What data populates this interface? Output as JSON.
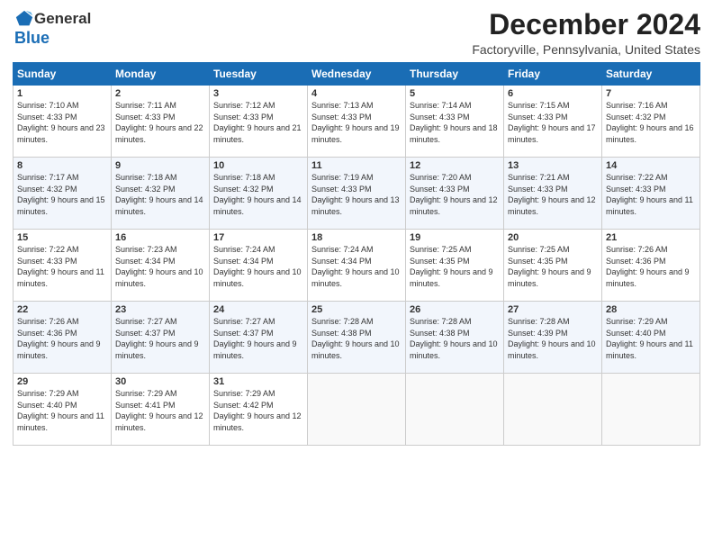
{
  "header": {
    "logo_line1": "General",
    "logo_line2": "Blue",
    "title": "December 2024",
    "subtitle": "Factoryville, Pennsylvania, United States"
  },
  "days_of_week": [
    "Sunday",
    "Monday",
    "Tuesday",
    "Wednesday",
    "Thursday",
    "Friday",
    "Saturday"
  ],
  "weeks": [
    [
      {
        "day": "1",
        "sunrise": "Sunrise: 7:10 AM",
        "sunset": "Sunset: 4:33 PM",
        "daylight": "Daylight: 9 hours and 23 minutes."
      },
      {
        "day": "2",
        "sunrise": "Sunrise: 7:11 AM",
        "sunset": "Sunset: 4:33 PM",
        "daylight": "Daylight: 9 hours and 22 minutes."
      },
      {
        "day": "3",
        "sunrise": "Sunrise: 7:12 AM",
        "sunset": "Sunset: 4:33 PM",
        "daylight": "Daylight: 9 hours and 21 minutes."
      },
      {
        "day": "4",
        "sunrise": "Sunrise: 7:13 AM",
        "sunset": "Sunset: 4:33 PM",
        "daylight": "Daylight: 9 hours and 19 minutes."
      },
      {
        "day": "5",
        "sunrise": "Sunrise: 7:14 AM",
        "sunset": "Sunset: 4:33 PM",
        "daylight": "Daylight: 9 hours and 18 minutes."
      },
      {
        "day": "6",
        "sunrise": "Sunrise: 7:15 AM",
        "sunset": "Sunset: 4:33 PM",
        "daylight": "Daylight: 9 hours and 17 minutes."
      },
      {
        "day": "7",
        "sunrise": "Sunrise: 7:16 AM",
        "sunset": "Sunset: 4:32 PM",
        "daylight": "Daylight: 9 hours and 16 minutes."
      }
    ],
    [
      {
        "day": "8",
        "sunrise": "Sunrise: 7:17 AM",
        "sunset": "Sunset: 4:32 PM",
        "daylight": "Daylight: 9 hours and 15 minutes."
      },
      {
        "day": "9",
        "sunrise": "Sunrise: 7:18 AM",
        "sunset": "Sunset: 4:32 PM",
        "daylight": "Daylight: 9 hours and 14 minutes."
      },
      {
        "day": "10",
        "sunrise": "Sunrise: 7:18 AM",
        "sunset": "Sunset: 4:32 PM",
        "daylight": "Daylight: 9 hours and 14 minutes."
      },
      {
        "day": "11",
        "sunrise": "Sunrise: 7:19 AM",
        "sunset": "Sunset: 4:33 PM",
        "daylight": "Daylight: 9 hours and 13 minutes."
      },
      {
        "day": "12",
        "sunrise": "Sunrise: 7:20 AM",
        "sunset": "Sunset: 4:33 PM",
        "daylight": "Daylight: 9 hours and 12 minutes."
      },
      {
        "day": "13",
        "sunrise": "Sunrise: 7:21 AM",
        "sunset": "Sunset: 4:33 PM",
        "daylight": "Daylight: 9 hours and 12 minutes."
      },
      {
        "day": "14",
        "sunrise": "Sunrise: 7:22 AM",
        "sunset": "Sunset: 4:33 PM",
        "daylight": "Daylight: 9 hours and 11 minutes."
      }
    ],
    [
      {
        "day": "15",
        "sunrise": "Sunrise: 7:22 AM",
        "sunset": "Sunset: 4:33 PM",
        "daylight": "Daylight: 9 hours and 11 minutes."
      },
      {
        "day": "16",
        "sunrise": "Sunrise: 7:23 AM",
        "sunset": "Sunset: 4:34 PM",
        "daylight": "Daylight: 9 hours and 10 minutes."
      },
      {
        "day": "17",
        "sunrise": "Sunrise: 7:24 AM",
        "sunset": "Sunset: 4:34 PM",
        "daylight": "Daylight: 9 hours and 10 minutes."
      },
      {
        "day": "18",
        "sunrise": "Sunrise: 7:24 AM",
        "sunset": "Sunset: 4:34 PM",
        "daylight": "Daylight: 9 hours and 10 minutes."
      },
      {
        "day": "19",
        "sunrise": "Sunrise: 7:25 AM",
        "sunset": "Sunset: 4:35 PM",
        "daylight": "Daylight: 9 hours and 9 minutes."
      },
      {
        "day": "20",
        "sunrise": "Sunrise: 7:25 AM",
        "sunset": "Sunset: 4:35 PM",
        "daylight": "Daylight: 9 hours and 9 minutes."
      },
      {
        "day": "21",
        "sunrise": "Sunrise: 7:26 AM",
        "sunset": "Sunset: 4:36 PM",
        "daylight": "Daylight: 9 hours and 9 minutes."
      }
    ],
    [
      {
        "day": "22",
        "sunrise": "Sunrise: 7:26 AM",
        "sunset": "Sunset: 4:36 PM",
        "daylight": "Daylight: 9 hours and 9 minutes."
      },
      {
        "day": "23",
        "sunrise": "Sunrise: 7:27 AM",
        "sunset": "Sunset: 4:37 PM",
        "daylight": "Daylight: 9 hours and 9 minutes."
      },
      {
        "day": "24",
        "sunrise": "Sunrise: 7:27 AM",
        "sunset": "Sunset: 4:37 PM",
        "daylight": "Daylight: 9 hours and 9 minutes."
      },
      {
        "day": "25",
        "sunrise": "Sunrise: 7:28 AM",
        "sunset": "Sunset: 4:38 PM",
        "daylight": "Daylight: 9 hours and 10 minutes."
      },
      {
        "day": "26",
        "sunrise": "Sunrise: 7:28 AM",
        "sunset": "Sunset: 4:38 PM",
        "daylight": "Daylight: 9 hours and 10 minutes."
      },
      {
        "day": "27",
        "sunrise": "Sunrise: 7:28 AM",
        "sunset": "Sunset: 4:39 PM",
        "daylight": "Daylight: 9 hours and 10 minutes."
      },
      {
        "day": "28",
        "sunrise": "Sunrise: 7:29 AM",
        "sunset": "Sunset: 4:40 PM",
        "daylight": "Daylight: 9 hours and 11 minutes."
      }
    ],
    [
      {
        "day": "29",
        "sunrise": "Sunrise: 7:29 AM",
        "sunset": "Sunset: 4:40 PM",
        "daylight": "Daylight: 9 hours and 11 minutes."
      },
      {
        "day": "30",
        "sunrise": "Sunrise: 7:29 AM",
        "sunset": "Sunset: 4:41 PM",
        "daylight": "Daylight: 9 hours and 12 minutes."
      },
      {
        "day": "31",
        "sunrise": "Sunrise: 7:29 AM",
        "sunset": "Sunset: 4:42 PM",
        "daylight": "Daylight: 9 hours and 12 minutes."
      },
      null,
      null,
      null,
      null
    ]
  ]
}
